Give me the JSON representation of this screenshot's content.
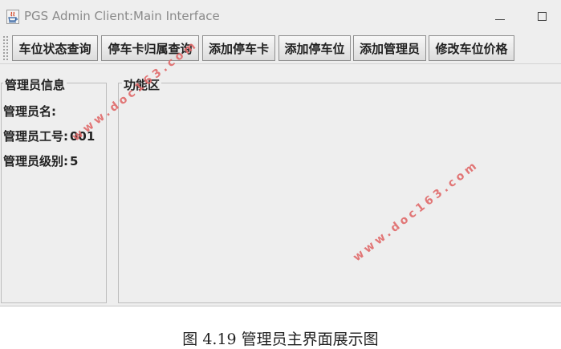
{
  "window": {
    "title": "PGS Admin Client:Main Interface"
  },
  "toolbar": {
    "buttons": [
      {
        "label": "车位状态查询"
      },
      {
        "label": "停车卡归属查询"
      },
      {
        "label": "添加停车卡"
      },
      {
        "label": "添加停车位"
      },
      {
        "label": "添加管理员"
      },
      {
        "label": "修改车位价格"
      }
    ]
  },
  "admin_info": {
    "legend": "管理员信息",
    "name_label": "管理员名:",
    "name_value": "",
    "id_label": "管理员工号:",
    "id_value": "001",
    "level_label": "管理员级别:",
    "level_value": "5"
  },
  "function_area": {
    "legend": "功能区"
  },
  "watermark": {
    "text": "www.doc163.com"
  },
  "caption": "图 4.19 管理员主界面展示图",
  "colors": {
    "window_bg": "#eeeeee",
    "watermark": "#e06a6a",
    "title_text": "#8a8a8a"
  }
}
